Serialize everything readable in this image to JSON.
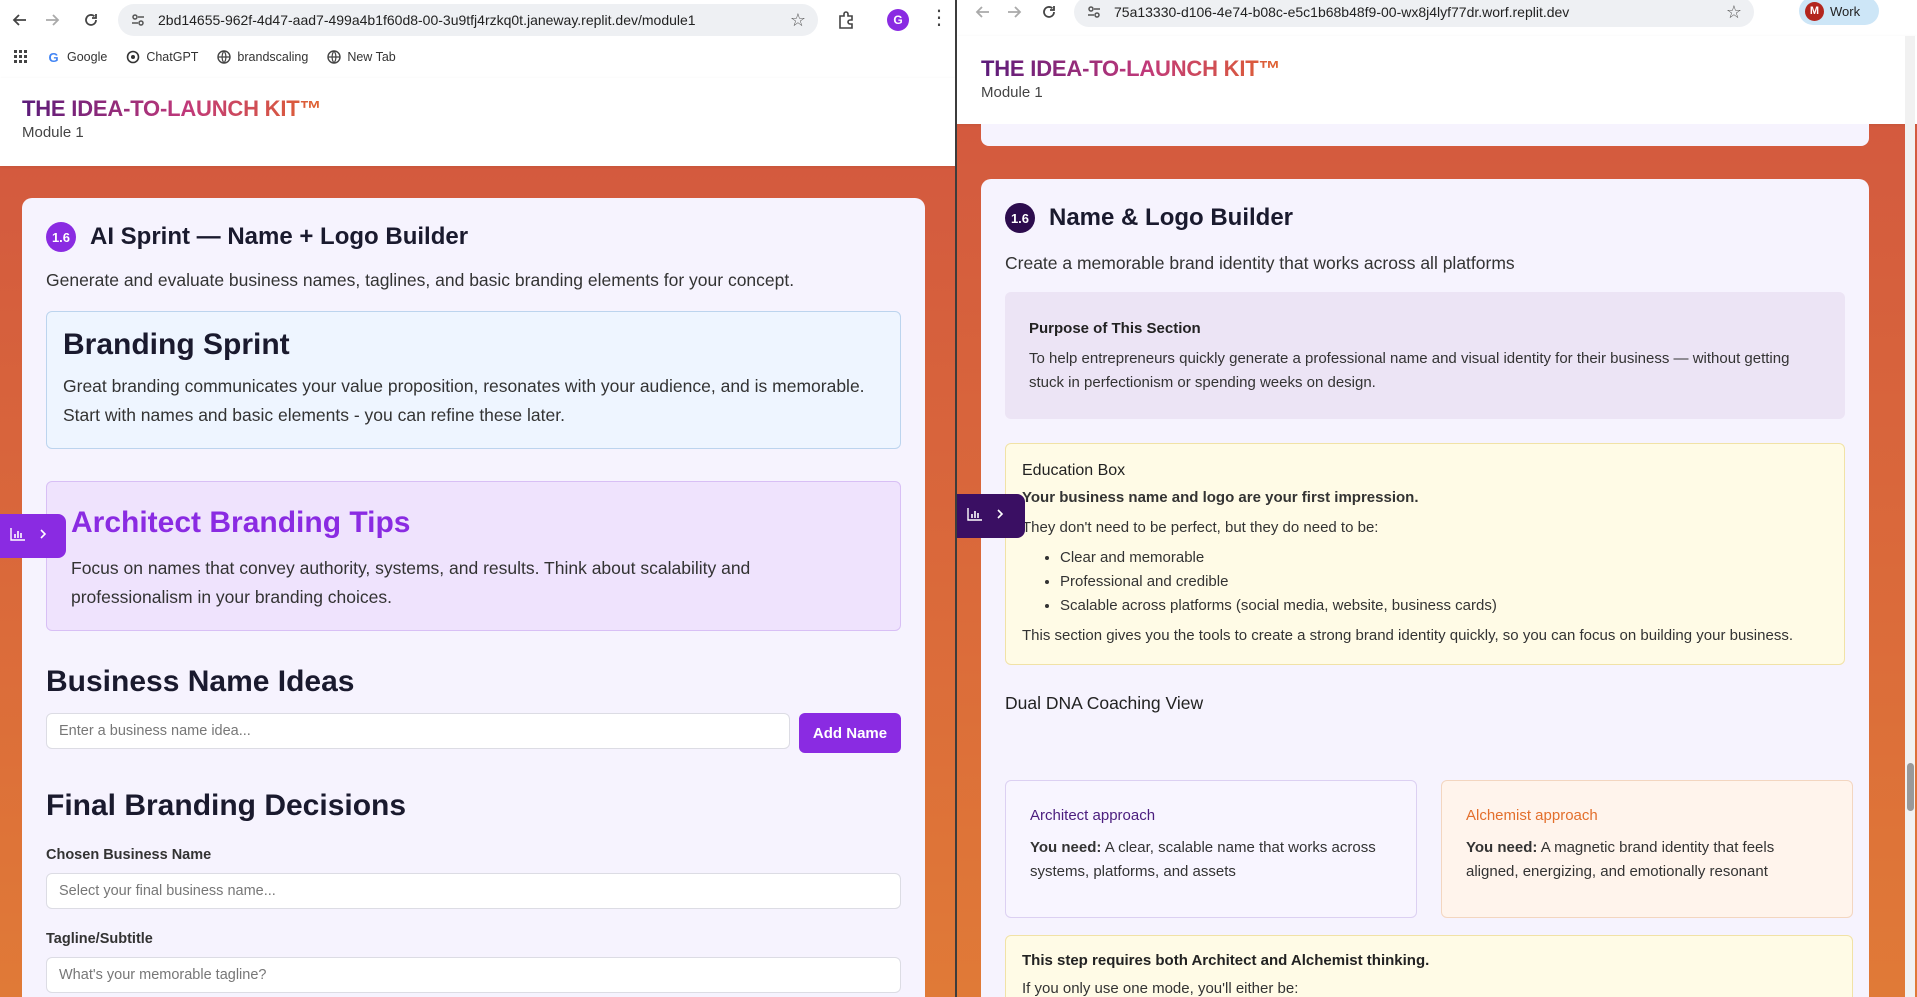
{
  "left_window": {
    "url": "2bd14655-962f-4d47-aad7-499a4b1f60d8-00-3u9tfj4rzkq0t.janeway.replit.dev/module1",
    "profile_initial": "G",
    "bookmarks": [
      "Google",
      "ChatGPT",
      "brandscaling",
      "New Tab"
    ],
    "header": {
      "brand": "THE IDEA-TO-LAUNCH KIT™",
      "module": "Module 1"
    },
    "section": {
      "number": "1.6",
      "title": "AI Sprint — Name + Logo Builder",
      "description": "Generate and evaluate business names, taglines, and basic branding elements for your concept."
    },
    "branding_sprint": {
      "heading": "Branding Sprint",
      "body": "Great branding communicates your value proposition, resonates with your audience, and is memorable. Start with names and basic elements - you can refine these later."
    },
    "architect_tips": {
      "heading": "Architect Branding Tips",
      "body": "Focus on names that convey authority, systems, and results. Think about scalability and professionalism in your branding choices."
    },
    "name_ideas": {
      "heading": "Business Name Ideas",
      "input_placeholder": "Enter a business name idea...",
      "button": "Add Name"
    },
    "final_decisions": {
      "heading": "Final Branding Decisions",
      "chosen_label": "Chosen Business Name",
      "chosen_placeholder": "Select your final business name...",
      "tagline_label": "Tagline/Subtitle",
      "tagline_placeholder": "What's your memorable tagline?"
    }
  },
  "right_window": {
    "url": "75a13330-d106-4e74-b08c-e5c1b68b48f9-00-wx8j4lyf77dr.worf.replit.dev",
    "profile_initial": "M",
    "profile_label": "Work",
    "header": {
      "brand": "THE IDEA-TO-LAUNCH KIT™",
      "module": "Module 1"
    },
    "section": {
      "number": "1.6",
      "title": "Name & Logo Builder",
      "description": "Create a memorable brand identity that works across all platforms"
    },
    "purpose": {
      "heading": "Purpose of This Section",
      "body": "To help entrepreneurs quickly generate a professional name and visual identity for their business — without getting stuck in perfectionism or spending weeks on design."
    },
    "education": {
      "heading": "Education Box",
      "lead": "Your business name and logo are your first impression.",
      "intro": "They don't need to be perfect, but they do need to be:",
      "bullets": [
        "Clear and memorable",
        "Professional and credible",
        "Scalable across platforms (social media, website, business cards)"
      ],
      "closing": "This section gives you the tools to create a strong brand identity quickly, so you can focus on building your business."
    },
    "dual_dna": {
      "heading": "Dual DNA Coaching View",
      "architect": {
        "title": "Architect approach",
        "need_label": "You need:",
        "need_text": "A clear, scalable name that works across systems, platforms, and assets"
      },
      "alchemist": {
        "title": "Alchemist approach",
        "need_label": "You need:",
        "need_text": "A magnetic brand identity that feels aligned, energizing, and emotionally resonant"
      }
    },
    "both_modes": {
      "heading": "This step requires both Architect and Alchemist thinking.",
      "body": "If you only use one mode, you'll either be:"
    }
  },
  "colors": {
    "purple": "#8a2be2",
    "dark_purple": "#4b1d7e",
    "orange_bg": "#d95f3c",
    "alchemist_orange": "#e36f2c"
  }
}
